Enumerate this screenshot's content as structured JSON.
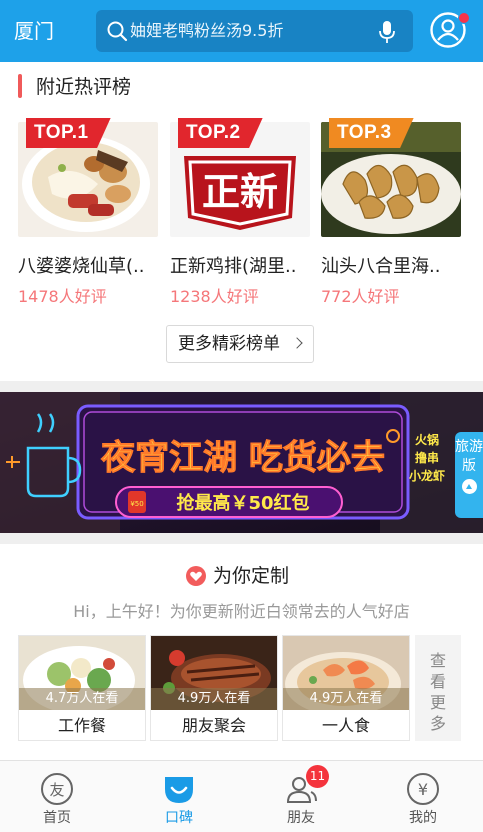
{
  "header": {
    "city": "厦门",
    "search_placeholder": "妯娌老鸭粉丝汤9.5折"
  },
  "hot_list": {
    "title": "附近热评榜",
    "items": [
      {
        "rank": "TOP.1",
        "name": "八婆婆烧仙草(..",
        "reviews": "1478人好评"
      },
      {
        "rank": "TOP.2",
        "name": "正新鸡排(湖里..",
        "reviews": "1238人好评",
        "logo_text": "正新"
      },
      {
        "rank": "TOP.3",
        "name": "汕头八合里海..",
        "reviews": "772人好评"
      }
    ],
    "more_label": "更多精彩榜单"
  },
  "banner": {
    "headline": "夜宵江湖 吃货必去",
    "subline": "抢最高￥50红包",
    "side_text": [
      "火锅",
      "撸串",
      "小龙虾"
    ],
    "badge": "¥50"
  },
  "travel_tab": {
    "label": "旅游版"
  },
  "custom": {
    "title": "为你定制",
    "subtitle": "Hi，上午好！为你更新附近白领常去的人气好店",
    "dishes": [
      {
        "name": "工作餐",
        "count": "4.7万人在看"
      },
      {
        "name": "朋友聚会",
        "count": "4.9万人在看"
      },
      {
        "name": "一人食",
        "count": "4.9万人在看"
      }
    ],
    "see_more": "查看更多"
  },
  "bottom_nav": {
    "items": [
      {
        "label": "首页",
        "icon": "friend-icon"
      },
      {
        "label": "口碑",
        "icon": "koubei-smile-icon"
      },
      {
        "label": "朋友",
        "icon": "friends-icon",
        "badge": "11"
      },
      {
        "label": "我的",
        "icon": "yuan-icon"
      }
    ]
  },
  "colors": {
    "header_blue": "#1ea1e9",
    "accent_red": "#f05a5a",
    "score_red": "#f5777a",
    "active_blue": "#1a9be6"
  }
}
